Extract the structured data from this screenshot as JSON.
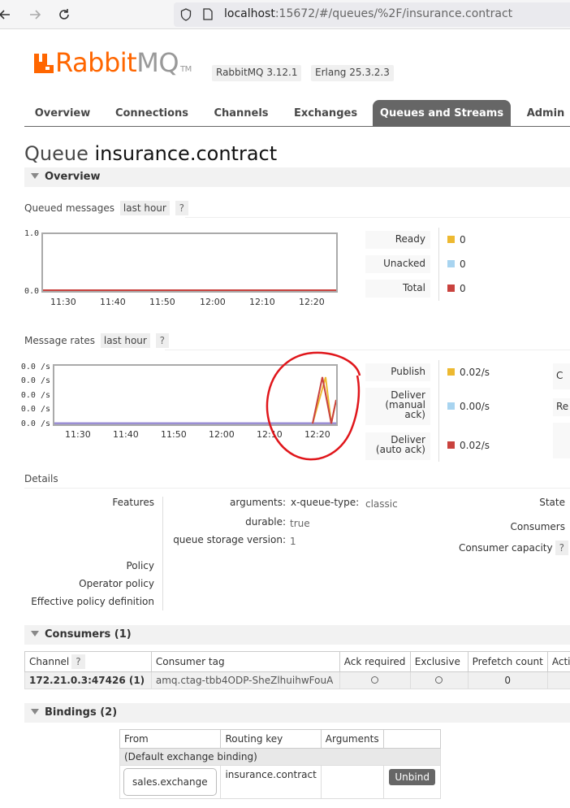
{
  "browser": {
    "url_host": "localhost",
    "url_rest": ":15672/#/queues/%2F/insurance.contract"
  },
  "header": {
    "logo_main": "RabbitMQ",
    "logo_rabbit": "Rabbit",
    "logo_mq": "MQ",
    "logo_tm": "TM",
    "rabbitmq_version": "RabbitMQ 3.12.1",
    "erlang_version": "Erlang 25.3.2.3"
  },
  "tabs": [
    {
      "label": "Overview"
    },
    {
      "label": "Connections"
    },
    {
      "label": "Channels"
    },
    {
      "label": "Exchanges"
    },
    {
      "label": "Queues and Streams"
    },
    {
      "label": "Admin"
    }
  ],
  "page": {
    "title_prefix": "Queue",
    "queue_name": "insurance.contract"
  },
  "overview_section": {
    "title": "Overview",
    "queued_messages": {
      "label": "Queued messages",
      "range": "last hour",
      "help": "?",
      "y_ticks": [
        "1.0",
        "0.0"
      ],
      "x_ticks": [
        "11:30",
        "11:40",
        "11:50",
        "12:00",
        "12:10",
        "12:20"
      ],
      "legend": [
        {
          "label": "Ready",
          "value": "0",
          "color": "#edb931"
        },
        {
          "label": "Unacked",
          "value": "0",
          "color": "#a8d4f0"
        },
        {
          "label": "Total",
          "value": "0",
          "color": "#c9423e"
        }
      ]
    },
    "message_rates": {
      "label": "Message rates",
      "range": "last hour",
      "help": "?",
      "y_ticks": [
        "0.0 /s",
        "0.0 /s",
        "0.0 /s",
        "0.0 /s",
        "0.0 /s"
      ],
      "x_ticks": [
        "11:30",
        "11:40",
        "11:50",
        "12:00",
        "12:10",
        "12:20"
      ],
      "legend": [
        {
          "label": "Publish",
          "value": "0.02/s",
          "color": "#edb931"
        },
        {
          "label": "Deliver\n(manual\nack)",
          "label_lines": [
            "Deliver",
            "(manual",
            "ack)"
          ],
          "value": "0.00/s",
          "color": "#a8d4f0"
        },
        {
          "label": "Deliver\n(auto ack)",
          "label_lines": [
            "Deliver",
            "(auto ack)"
          ],
          "value": "0.02/s",
          "color": "#c9423e"
        }
      ],
      "clipped_right": [
        "C",
        "Re"
      ]
    }
  },
  "details": {
    "title": "Details",
    "features_label": "Features",
    "arguments_label": "arguments:",
    "arguments_key": "x-queue-type:",
    "arguments_value": "classic",
    "durable_label": "durable:",
    "durable_value": "true",
    "storage_label": "queue storage version:",
    "storage_value": "1",
    "policy_label": "Policy",
    "operator_policy_label": "Operator policy",
    "effective_policy_label": "Effective policy definition",
    "state_label": "State",
    "consumers_label": "Consumers",
    "consumer_capacity_label": "Consumer capacity",
    "help": "?"
  },
  "consumers": {
    "title": "Consumers (1)",
    "columns": [
      "Channel",
      "Consumer tag",
      "Ack required",
      "Exclusive",
      "Prefetch count",
      "Acti"
    ],
    "channel_help": "?",
    "rows": [
      {
        "channel": "172.21.0.3:47426 (1)",
        "tag": "amq.ctag-tbb4ODP-SheZlhuihwFouA",
        "prefetch": "0"
      }
    ]
  },
  "bindings": {
    "title": "Bindings (2)",
    "columns": [
      "From",
      "Routing key",
      "Arguments",
      ""
    ],
    "default_binding": "(Default exchange binding)",
    "rows": [
      {
        "from": "sales.exchange",
        "routing_key": "insurance.contract",
        "arguments": "",
        "action": "Unbind"
      }
    ]
  }
}
